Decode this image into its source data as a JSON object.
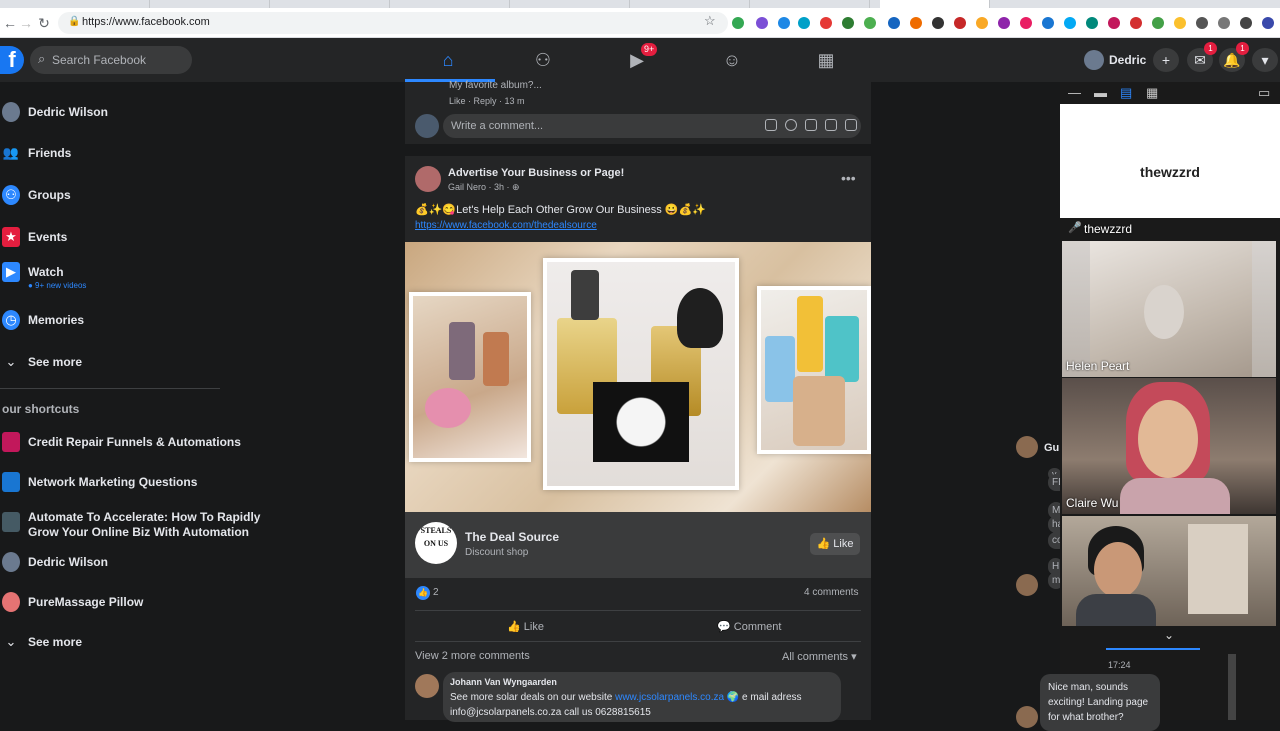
{
  "browser": {
    "url": "https://www.facebook.com",
    "tabs": [
      "",
      "",
      "",
      "",
      "",
      "",
      "",
      "",
      "",
      "",
      ""
    ]
  },
  "header": {
    "logo_letter": "f",
    "search_placeholder": "Search Facebook",
    "watch_badge": "9+",
    "profile_name": "Dedric",
    "plus": "+",
    "messenger_badge": "1",
    "notifications_badge": "1"
  },
  "sidebar": {
    "items": [
      {
        "label": "Dedric Wilson",
        "icon": "avatar"
      },
      {
        "label": "Friends",
        "icon": "friends-icon"
      },
      {
        "label": "Groups",
        "icon": "groups-icon"
      },
      {
        "label": "Events",
        "icon": "events-icon"
      },
      {
        "label": "Watch",
        "icon": "watch-icon",
        "sub": "● 9+ new videos"
      },
      {
        "label": "Memories",
        "icon": "memories-icon"
      },
      {
        "label": "See more",
        "icon": "chevron-down-icon"
      }
    ],
    "shortcuts_heading": "our shortcuts",
    "shortcuts": [
      {
        "label": "Credit Repair Funnels & Automations"
      },
      {
        "label": "Network Marketing Questions"
      },
      {
        "label": "Automate To Accelerate: How To Rapidly",
        "label2": "Grow Your Online Biz With Automation"
      },
      {
        "label": "Dedric Wilson"
      },
      {
        "label": "PureMassage Pillow"
      },
      {
        "label": "See more"
      }
    ]
  },
  "prev_post": {
    "reply_text": "My favorite album?...",
    "meta": "Like · Reply · 13 m",
    "comment_placeholder": "Write a comment..."
  },
  "post": {
    "title": "Advertise Your Business or Page!",
    "meta": "Gail Nero · 3h · ⊕",
    "text": "💰✨😋Let's Help Each Other Grow Our Business 😀💰✨",
    "link": "https://www.facebook.com/thedealsource",
    "page_logo": "STEALS ON US",
    "page_name": "The Deal Source",
    "page_category": "Discount shop",
    "page_like": "Like",
    "reaction_count": "2",
    "comments_count": "4 comments",
    "like_action": "Like",
    "comment_action": "Comment",
    "view_more": "View 2 more comments",
    "all_comments": "All comments ▾",
    "comment": {
      "author": "Johann Van Wyngaarden",
      "text_before": "See more solar deals on our website ",
      "link": "www.jcsolarpanels.co.za",
      "text_after": " 🌍 e mail adress info@jcsolarpanels.co.za call us 0628815615"
    }
  },
  "chat_strip": {
    "name_fragment": "Gui",
    "fragments": [
      "y",
      "FB",
      "M",
      "ha",
      "co",
      "H",
      "m"
    ]
  },
  "zoom": {
    "speaker_name": "thewzzrd",
    "tiles": [
      {
        "label": "thewzzrd"
      },
      {
        "label": "Helen Peart"
      },
      {
        "label": "Claire Wu"
      },
      {
        "label": ""
      }
    ],
    "timestamp": "17:24",
    "message": "Nice man, sounds exciting! Landing page for what brother?"
  },
  "colors": {
    "accent": "#2d88ff",
    "fb_blue": "#1877f2",
    "badge_red": "#e41e3f"
  }
}
